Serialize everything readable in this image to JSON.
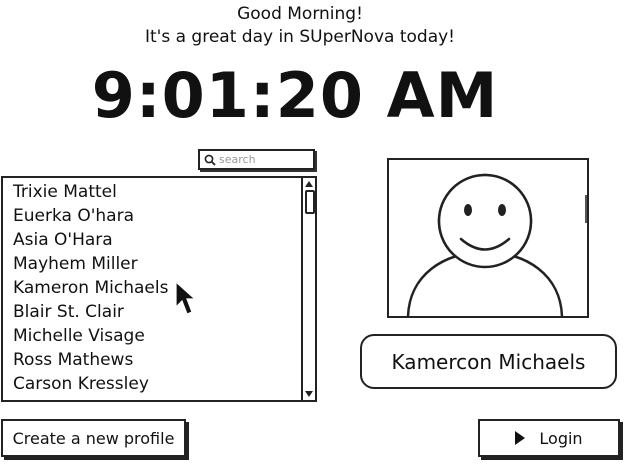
{
  "header": {
    "greeting": "Good Morning!",
    "tagline": "It's a great day in SUperNova today!"
  },
  "clock": {
    "time": "9:01:20 AM"
  },
  "search": {
    "placeholder": "search",
    "value": ""
  },
  "profiles": {
    "items": [
      "Trixie Mattel",
      "Euerka O'hara",
      "Asia O'Hara",
      "Mayhem Miller",
      "Kameron Michaels",
      "Blair St. Clair",
      "Michelle Visage",
      "Ross Mathews",
      "Carson Kressley"
    ]
  },
  "selected_profile": {
    "name": "Kamercon Michaels"
  },
  "icons": {
    "search": "search-icon",
    "avatar": "avatar-placeholder-icon",
    "login": "play-icon",
    "cursor": "mouse-pointer-icon"
  },
  "buttons": {
    "create_profile": "Create a new profile",
    "login": "Login"
  }
}
